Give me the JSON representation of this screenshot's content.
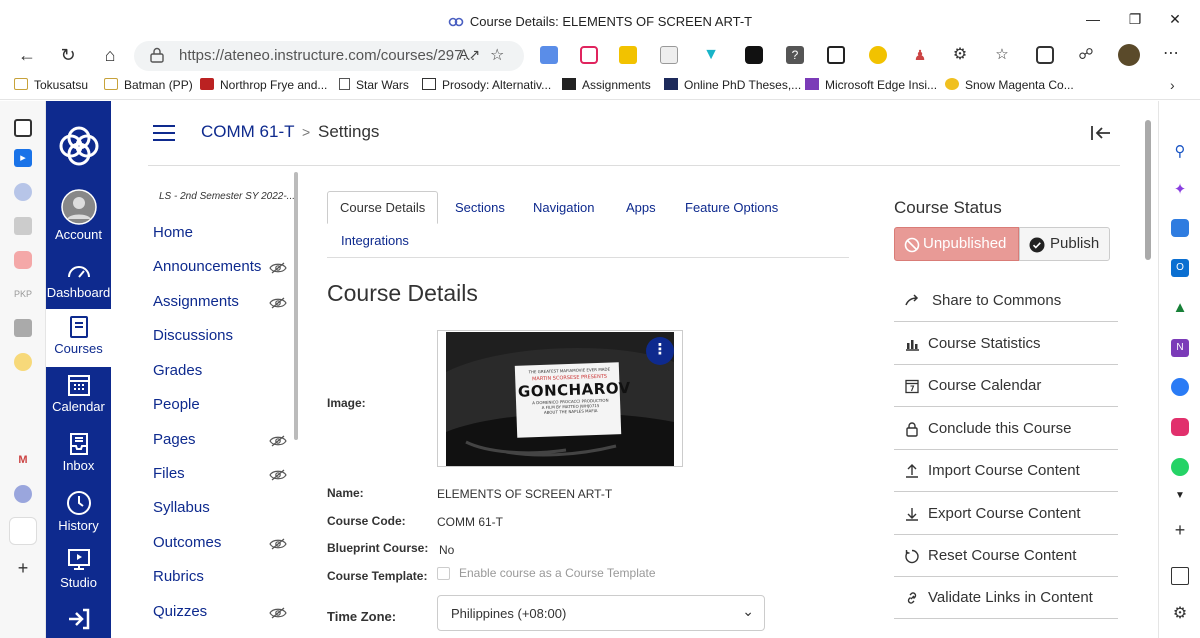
{
  "browser": {
    "window_title": "Course Details: ELEMENTS OF SCREEN ART-T",
    "url": "https://ateneo.instructure.com/courses/297...",
    "bookmarks": [
      "Tokusatsu",
      "Batman (PP)",
      "Northrop Frye and...",
      "Star Wars",
      "Prosody: Alternativ...",
      "Assignments",
      "Online PhD Theses,...",
      "Microsoft Edge Insi...",
      "Snow Magenta Co..."
    ],
    "edge_left_labels": {
      "pkp": "PKP"
    }
  },
  "global_nav": {
    "items": [
      "Account",
      "Dashboard",
      "Courses",
      "Calendar",
      "Inbox",
      "History",
      "Studio"
    ],
    "active": "Courses"
  },
  "breadcrumb": {
    "course": "COMM 61-T",
    "separator": ">",
    "page": "Settings"
  },
  "course_nav": {
    "term": "LS - 2nd Semester SY 2022-...",
    "items": [
      {
        "label": "Home",
        "hidden": false
      },
      {
        "label": "Announcements",
        "hidden": true
      },
      {
        "label": "Assignments",
        "hidden": true
      },
      {
        "label": "Discussions",
        "hidden": false
      },
      {
        "label": "Grades",
        "hidden": false
      },
      {
        "label": "People",
        "hidden": false
      },
      {
        "label": "Pages",
        "hidden": true
      },
      {
        "label": "Files",
        "hidden": true
      },
      {
        "label": "Syllabus",
        "hidden": false
      },
      {
        "label": "Outcomes",
        "hidden": true
      },
      {
        "label": "Rubrics",
        "hidden": false
      },
      {
        "label": "Quizzes",
        "hidden": true
      }
    ]
  },
  "tabs": [
    "Course Details",
    "Sections",
    "Navigation",
    "Apps",
    "Feature Options",
    "Integrations"
  ],
  "main": {
    "title": "Course Details",
    "image_label": "Image:",
    "image_text": {
      "line1": "THE GREATEST MAFIAMOVIE EVER MADE",
      "line2": "MARTIN SCORSESE PRESENTS",
      "line3": "GONCHAROV",
      "line4": "A DOMENICO PROCACCI PRODUCTION",
      "line5": "A FILM BY MATTEO JWHJ0715",
      "line6": "ABOUT THE NAPLES MAFIA"
    },
    "fields": {
      "name_label": "Name:",
      "name_value": "ELEMENTS OF SCREEN ART-T",
      "code_label": "Course Code:",
      "code_value": "COMM 61-T",
      "blueprint_label": "Blueprint Course:",
      "blueprint_value": "No",
      "template_label": "Course Template:",
      "template_checkbox": "Enable course as a Course Template",
      "timezone_label": "Time Zone:",
      "timezone_value": "Philippines (+08:00)"
    }
  },
  "sidebar": {
    "status_heading": "Course Status",
    "unpublished_label": "Unpublished",
    "publish_label": "Publish",
    "links": [
      {
        "label": "Share to Commons",
        "icon": "share-icon"
      },
      {
        "label": "Course Statistics",
        "icon": "bar-chart-icon"
      },
      {
        "label": "Course Calendar",
        "icon": "calendar-icon"
      },
      {
        "label": "Conclude this Course",
        "icon": "lock-icon"
      },
      {
        "label": "Import Course Content",
        "icon": "upload-icon"
      },
      {
        "label": "Export Course Content",
        "icon": "download-icon"
      },
      {
        "label": "Reset Course Content",
        "icon": "reset-icon"
      },
      {
        "label": "Validate Links in Content",
        "icon": "link-icon"
      }
    ]
  },
  "colors": {
    "canvas_nav": "#0e2a8e",
    "unpublished": "#e89a96",
    "link": "#0e2a8e"
  }
}
